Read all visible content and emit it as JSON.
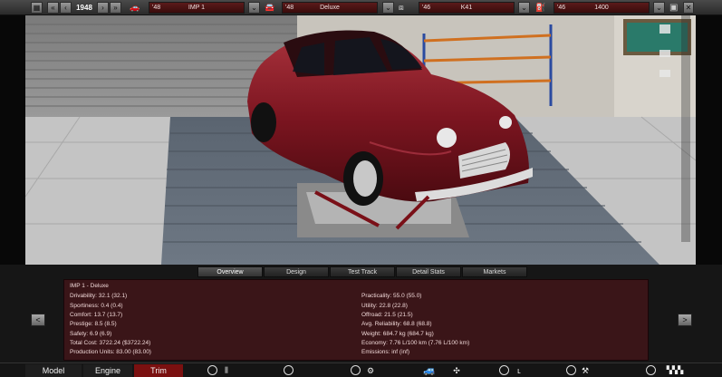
{
  "topbar": {
    "year": "1948",
    "model_year": "'48",
    "model_name": "IMP 1",
    "trim_year": "'48",
    "trim_name": "Deluxe",
    "chassis_year": "'46",
    "chassis_name": "K41",
    "engine_year": "'46",
    "engine_name": "1400"
  },
  "tabs": [
    "Overview",
    "Design",
    "Test Track",
    "Detail Stats",
    "Markets"
  ],
  "stats": {
    "title": "IMP 1 - Deluxe",
    "left": [
      "Drivability: 32.1 (32.1)",
      "Sportiness: 0.4 (0.4)",
      "Comfort: 13.7 (13.7)",
      "Prestige: 8.5 (8.5)",
      "Safety: 6.9 (6.9)",
      "Total Cost: 3722.24 ($3722.24)",
      "Production Units: 83.00 (83.00)"
    ],
    "right": [
      "Practicality: 55.0 (55.0)",
      "Utility: 22.8 (22.8)",
      "Offroad: 21.5 (21.5)",
      "Avg. Reliability: 68.8 (68.8)",
      "Weight: 684.7 kg (684.7 kg)",
      "Economy: 7.76 L/100 km (7.76 L/100 km)",
      "Emissions: inf (inf)"
    ]
  },
  "nav": {
    "model": "Model",
    "engine": "Engine",
    "trim": "Trim"
  },
  "colors": {
    "accent": "#7a1010",
    "field": "#4a1212",
    "car": "#8a1a22"
  }
}
